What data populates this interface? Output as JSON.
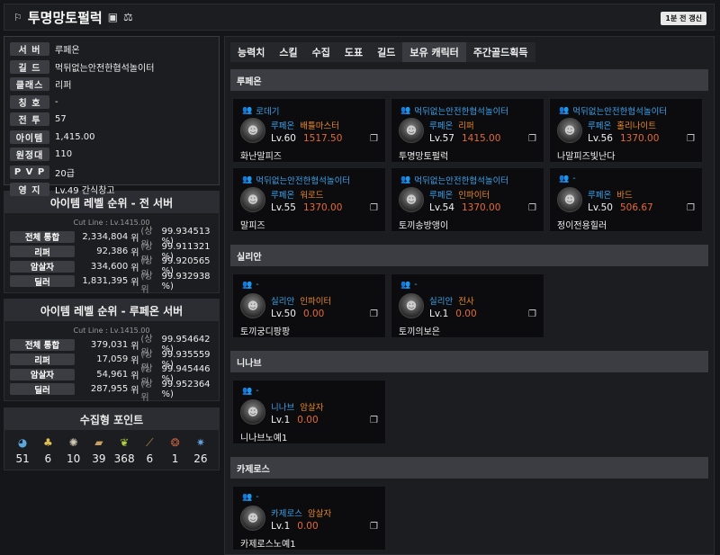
{
  "header": {
    "title": "투명망토펄럭",
    "refresh_label": "1분 전 갱신"
  },
  "info": [
    {
      "label": "서 버",
      "value": "루페온"
    },
    {
      "label": "길 드",
      "value": "먹뒤없는안전한협석놀이터"
    },
    {
      "label": "클래스",
      "value": "리퍼"
    },
    {
      "label": "칭 호",
      "value": "-"
    },
    {
      "label": "전 투",
      "value": "57"
    },
    {
      "label": "아이템",
      "value": "1,415.00"
    },
    {
      "label": "원정대",
      "value": "110"
    },
    {
      "label": "P V P",
      "value": "20급"
    },
    {
      "label": "영 지",
      "value": "Lv.49 간식창고"
    }
  ],
  "rank_all": {
    "title": "아이템 레벨 순위 - 전 서버",
    "cutline": "Cut Line : Lv.1415.00",
    "rows": [
      {
        "label": "전체 통합",
        "num": "2,334,804",
        "pct": "99.934513 %"
      },
      {
        "label": "리퍼",
        "num": "92,386",
        "pct": "99.911321 %"
      },
      {
        "label": "암살자",
        "num": "334,600",
        "pct": "99.920565 %"
      },
      {
        "label": "딜러",
        "num": "1,831,395",
        "pct": "99.932938 %"
      }
    ]
  },
  "rank_server": {
    "title": "아이템 레벨 순위 - 루페온 서버",
    "cutline": "Cut Line : Lv.1415.00",
    "rows": [
      {
        "label": "전체 통합",
        "num": "379,031",
        "pct": "99.954642 %"
      },
      {
        "label": "리퍼",
        "num": "17,059",
        "pct": "99.935559 %"
      },
      {
        "label": "암살자",
        "num": "54,961",
        "pct": "99.945446 %"
      },
      {
        "label": "딜러",
        "num": "287,955",
        "pct": "99.952364 %"
      }
    ]
  },
  "rank_texts": {
    "wi": "위",
    "sangwi": "(상위"
  },
  "collect": {
    "title": "수집형 포인트",
    "items": [
      {
        "icon": "island-heart-icon",
        "glyph": "◕",
        "color": "#5aa7e0",
        "value": "51"
      },
      {
        "icon": "seed-icon",
        "glyph": "♣",
        "color": "#e0c050",
        "value": "6"
      },
      {
        "icon": "art-icon",
        "glyph": "✺",
        "color": "#d0c8b0",
        "value": "10"
      },
      {
        "icon": "map-icon",
        "glyph": "▰",
        "color": "#c8a060",
        "value": "39"
      },
      {
        "icon": "leaf-icon",
        "glyph": "❦",
        "color": "#b0d040",
        "value": "368"
      },
      {
        "icon": "note-icon",
        "glyph": "⟋",
        "color": "#c89040",
        "value": "6"
      },
      {
        "icon": "medal-icon",
        "glyph": "❂",
        "color": "#c06040",
        "value": "1"
      },
      {
        "icon": "star-icon",
        "glyph": "✷",
        "color": "#60a0e0",
        "value": "26"
      }
    ]
  },
  "tabs": [
    "능력치",
    "스킬",
    "수집",
    "도표",
    "길드",
    "보유 캐릭터",
    "주간골드획득"
  ],
  "active_tab": 5,
  "sections": [
    {
      "server": "루페온",
      "cards": [
        {
          "guild": "로데기",
          "srv": "루페온",
          "cls": "배틀마스터",
          "lv": "Lv.60",
          "il": "1517.50",
          "name": "화난말피즈"
        },
        {
          "guild": "먹뒤없는안전한협석놀이터",
          "srv": "루페온",
          "cls": "리퍼",
          "lv": "Lv.57",
          "il": "1415.00",
          "name": "투명망토펄럭"
        },
        {
          "guild": "먹뒤없는안전한협석놀이터",
          "srv": "루페온",
          "cls": "홀리나이트",
          "lv": "Lv.56",
          "il": "1370.00",
          "name": "나말피즈빛난다"
        },
        {
          "guild": "먹뒤없는안전한협석놀이터",
          "srv": "루페온",
          "cls": "워로드",
          "lv": "Lv.55",
          "il": "1370.00",
          "name": "말피즈"
        },
        {
          "guild": "먹뒤없는안전한협석놀이터",
          "srv": "루페온",
          "cls": "인파이터",
          "lv": "Lv.54",
          "il": "1370.00",
          "name": "토끼송방앵이"
        },
        {
          "guild": "-",
          "srv": "루페온",
          "cls": "바드",
          "lv": "Lv.50",
          "il": "506.67",
          "name": "정이전용힐러"
        }
      ]
    },
    {
      "server": "실리안",
      "cards": [
        {
          "guild": "-",
          "srv": "실리안",
          "cls": "인파이터",
          "lv": "Lv.50",
          "il": "0.00",
          "name": "토끼궁디팡팡"
        },
        {
          "guild": "-",
          "srv": "실리안",
          "cls": "전사",
          "lv": "Lv.1",
          "il": "0.00",
          "name": "토끼의보은"
        }
      ]
    },
    {
      "server": "니나브",
      "cards": [
        {
          "guild": "-",
          "srv": "니나브",
          "cls": "암살자",
          "lv": "Lv.1",
          "il": "0.00",
          "name": "니나브노예1"
        }
      ]
    },
    {
      "server": "카제로스",
      "cards": [
        {
          "guild": "-",
          "srv": "카제로스",
          "cls": "암살자",
          "lv": "Lv.1",
          "il": "0.00",
          "name": "카제로스노예1"
        }
      ]
    }
  ]
}
